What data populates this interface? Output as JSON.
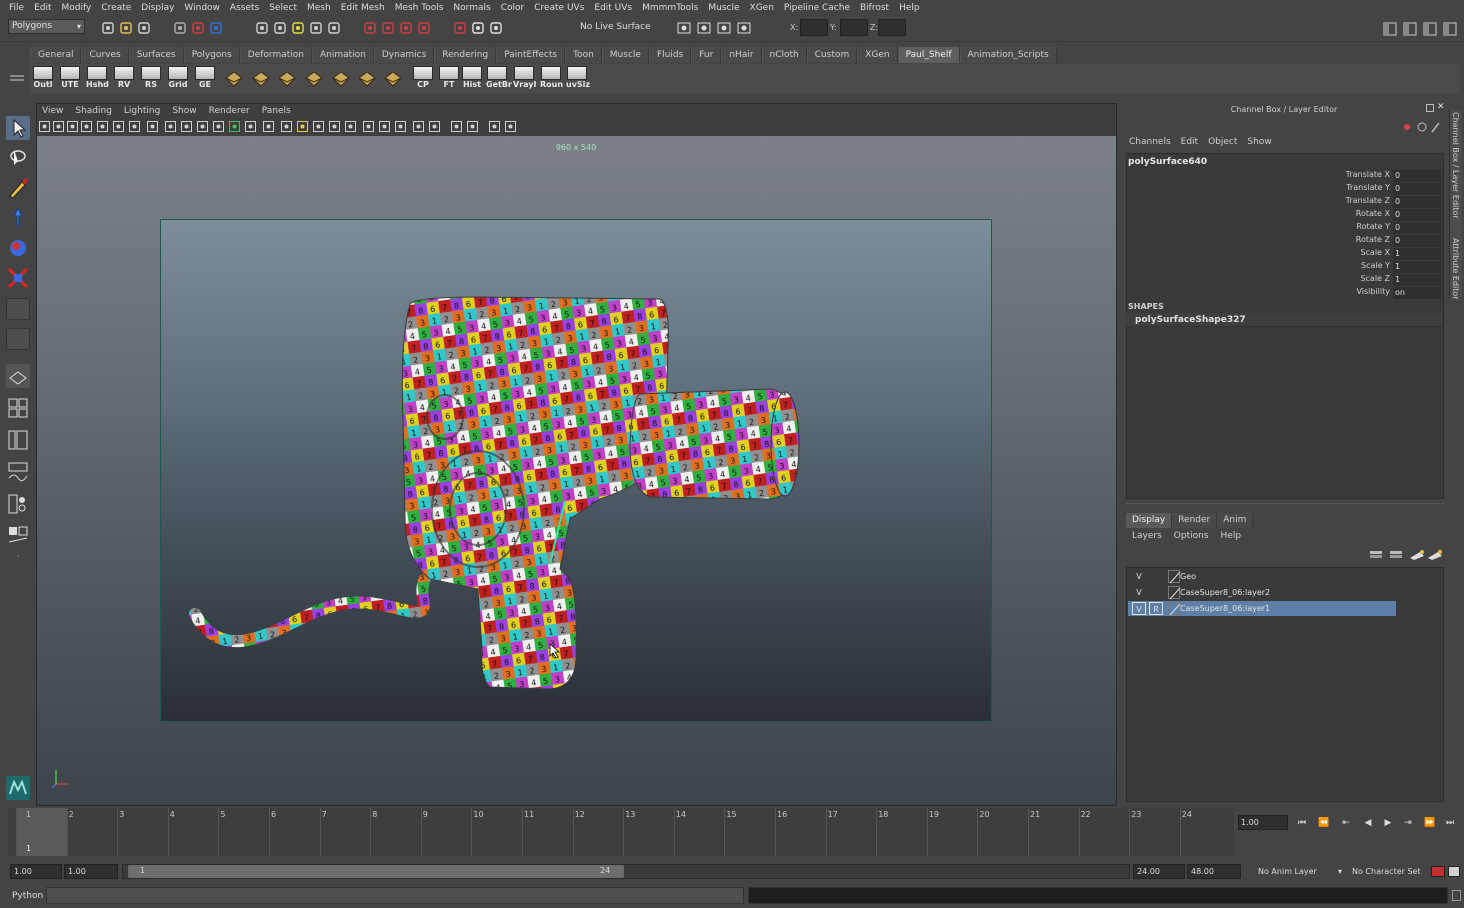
{
  "menubar": [
    "File",
    "Edit",
    "Modify",
    "Create",
    "Display",
    "Window",
    "Assets",
    "Select",
    "Mesh",
    "Edit Mesh",
    "Mesh Tools",
    "Normals",
    "Color",
    "Create UVs",
    "Edit UVs",
    "MmmmTools",
    "Muscle",
    "XGen",
    "Pipeline Cache",
    "Bifrost",
    "Help"
  ],
  "statusline": {
    "mode": "Polygons",
    "live_surface": "No Live Surface",
    "x_label": "X:",
    "y_label": "Y:",
    "z_label": "Z:"
  },
  "shelf": {
    "tabs": [
      "General",
      "Curves",
      "Surfaces",
      "Polygons",
      "Deformation",
      "Animation",
      "Dynamics",
      "Rendering",
      "PaintEffects",
      "Toon",
      "Muscle",
      "Fluids",
      "Fur",
      "nHair",
      "nCloth",
      "Custom",
      "XGen",
      "Paul_Shelf",
      "Animation_Scripts"
    ],
    "active_tab": "Paul_Shelf",
    "buttons": [
      {
        "label": "Outl",
        "icon": "outliner-icon"
      },
      {
        "label": "UTE",
        "icon": "uv-editor-icon"
      },
      {
        "label": "Hshd",
        "icon": "hypershade-icon"
      },
      {
        "label": "RV",
        "icon": "render-view-icon"
      },
      {
        "label": "RS",
        "icon": "render-settings-icon"
      },
      {
        "label": "Grid",
        "icon": "grid-icon"
      },
      {
        "label": "GE",
        "icon": "graph-editor-icon"
      },
      {
        "label": "CP",
        "icon": "center-pivot-icon"
      },
      {
        "label": "FT",
        "icon": "freeze-transform-icon"
      },
      {
        "label": "Hist",
        "icon": "delete-history-icon"
      },
      {
        "label": "GetBr",
        "icon": "get-brush-icon"
      },
      {
        "label": "VrayI",
        "icon": "vray-light-icon"
      },
      {
        "label": "Roun",
        "icon": "round-tool-icon"
      },
      {
        "label": "uvSiz",
        "icon": "uv-size-icon"
      }
    ]
  },
  "viewport": {
    "menu": [
      "View",
      "Shading",
      "Lighting",
      "Show",
      "Renderer",
      "Panels"
    ],
    "resolution_label": "960 x 540"
  },
  "channel_box": {
    "title": "Channel Box / Layer Editor",
    "menu": [
      "Channels",
      "Edit",
      "Object",
      "Show"
    ],
    "object_name": "polySurface640",
    "channels": [
      {
        "name": "Translate X",
        "value": "0"
      },
      {
        "name": "Translate Y",
        "value": "0"
      },
      {
        "name": "Translate Z",
        "value": "0"
      },
      {
        "name": "Rotate X",
        "value": "0"
      },
      {
        "name": "Rotate Y",
        "value": "0"
      },
      {
        "name": "Rotate Z",
        "value": "0"
      },
      {
        "name": "Scale X",
        "value": "1"
      },
      {
        "name": "Scale Y",
        "value": "1"
      },
      {
        "name": "Scale Z",
        "value": "1"
      },
      {
        "name": "Visibility",
        "value": "on"
      }
    ],
    "shapes_heading": "SHAPES",
    "shape_name": "polySurfaceShape327",
    "side_tabs": [
      "Channel Box / Layer Editor",
      "Attribute Editor"
    ]
  },
  "layer_editor": {
    "tabs": [
      "Display",
      "Render",
      "Anim"
    ],
    "active_tab": "Display",
    "menu": [
      "Layers",
      "Options",
      "Help"
    ],
    "layers": [
      {
        "v": "V",
        "r": "",
        "name": "Geo",
        "selected": false
      },
      {
        "v": "V",
        "r": "",
        "name": "CaseSuper8_06:layer2",
        "selected": false
      },
      {
        "v": "V",
        "r": "R",
        "name": "CaseSuper8_06:layer1",
        "selected": true
      }
    ]
  },
  "timeline": {
    "frames": [
      "1",
      "2",
      "3",
      "4",
      "5",
      "6",
      "7",
      "8",
      "9",
      "10",
      "11",
      "12",
      "13",
      "14",
      "15",
      "16",
      "17",
      "18",
      "19",
      "20",
      "21",
      "22",
      "23",
      "24"
    ],
    "current_frame_marker": "1",
    "current_frame": "1.00",
    "playback_controls": [
      "go-start-icon",
      "step-back-key-icon",
      "step-back-icon",
      "play-back-icon",
      "play-forward-icon",
      "step-forward-key-icon",
      "go-end-icon",
      "step-forward-icon"
    ]
  },
  "range": {
    "start": "1.00",
    "playback_start": "1.00",
    "slider_start": "1",
    "slider_end": "24",
    "playback_end": "24.00",
    "end": "48.00",
    "anim_layer": "No Anim Layer",
    "character_set": "No Character Set"
  },
  "command_line": {
    "label": "Python"
  }
}
